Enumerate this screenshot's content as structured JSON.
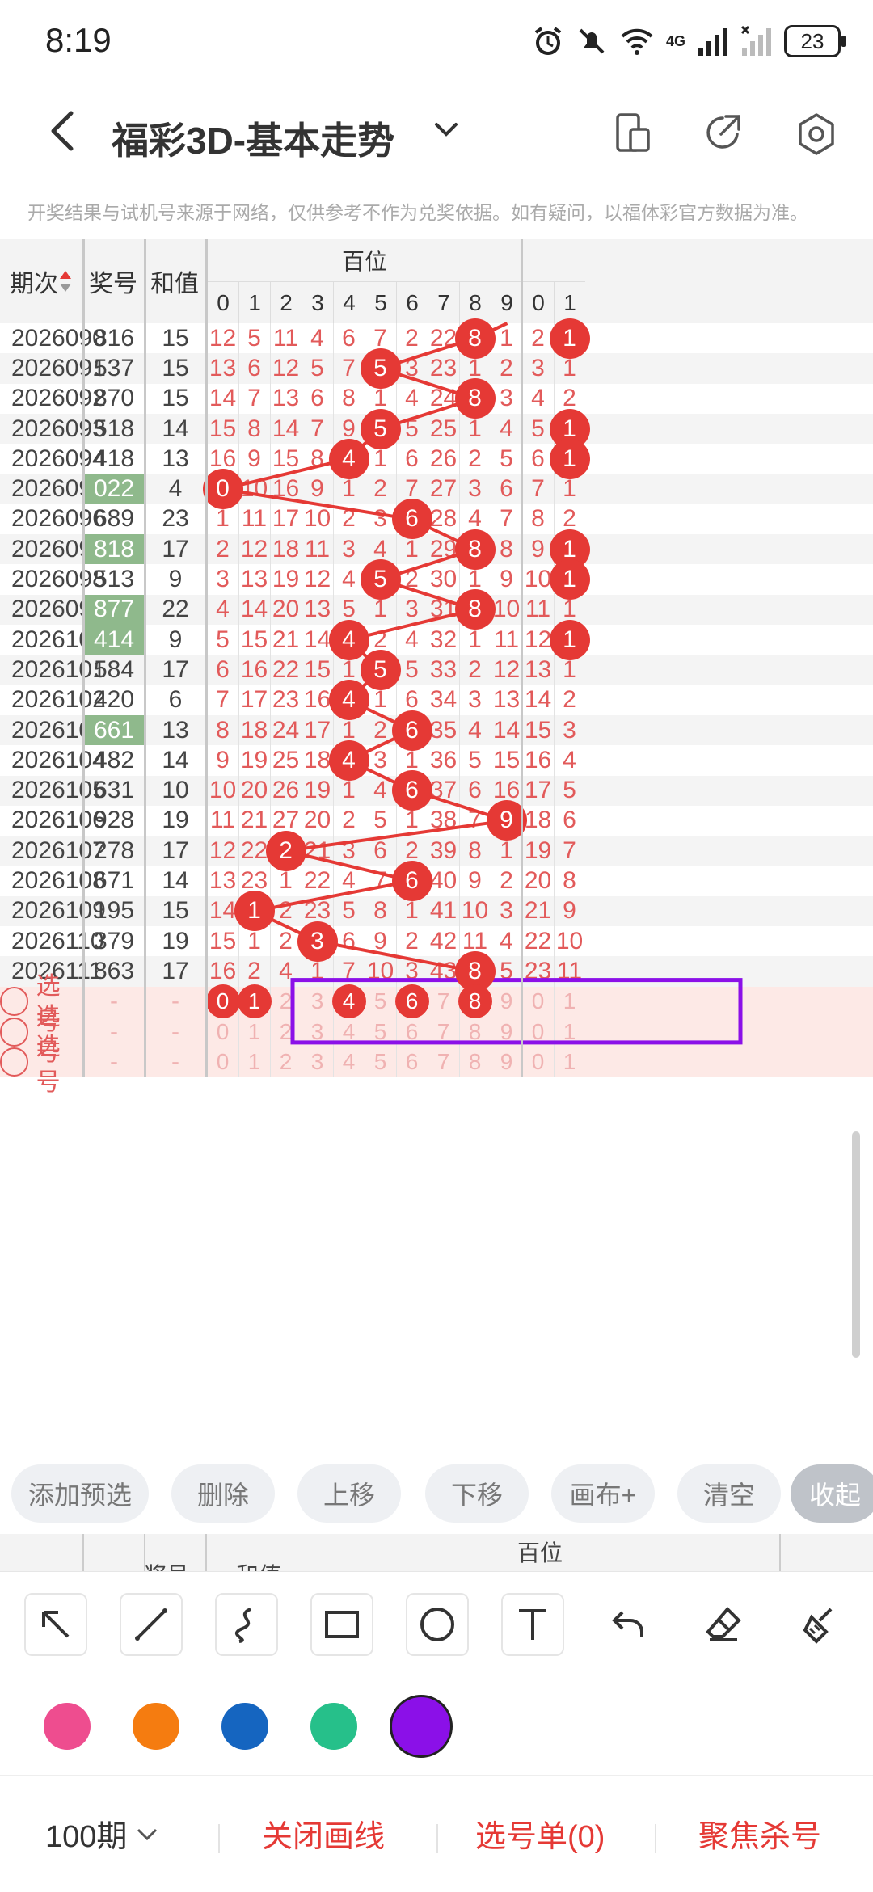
{
  "status": {
    "time": "8:19",
    "battery": "23",
    "network": "4G"
  },
  "header": {
    "title": "福彩3D-基本走势"
  },
  "disclaimer": "开奖结果与试机号来源于网络，仅供参考不作为兑奖依据。如有疑问，以福体彩官方数据为准。",
  "table": {
    "headers": {
      "period": "期次",
      "prize": "奖号",
      "sum": "和值",
      "hundreds": "百位",
      "tens_partial": [
        "0",
        "1"
      ]
    },
    "digits": [
      "0",
      "1",
      "2",
      "3",
      "4",
      "5",
      "6",
      "7",
      "8",
      "9"
    ],
    "rows": [
      {
        "period": "2026090",
        "prize": "816",
        "sum": "15",
        "hl": false,
        "h": [
          12,
          5,
          11,
          4,
          6,
          7,
          2,
          22,
          "8",
          1
        ],
        "t": [
          2,
          "1"
        ]
      },
      {
        "period": "2026091",
        "prize": "537",
        "sum": "15",
        "hl": false,
        "h": [
          13,
          6,
          12,
          5,
          7,
          "5",
          3,
          23,
          1,
          2
        ],
        "t": [
          3,
          1
        ]
      },
      {
        "period": "2026092",
        "prize": "870",
        "sum": "15",
        "hl": false,
        "h": [
          14,
          7,
          13,
          6,
          8,
          1,
          4,
          24,
          "8",
          3
        ],
        "t": [
          4,
          2
        ]
      },
      {
        "period": "2026093",
        "prize": "518",
        "sum": "14",
        "hl": false,
        "h": [
          15,
          8,
          14,
          7,
          9,
          "5",
          5,
          25,
          1,
          4
        ],
        "t": [
          5,
          "1"
        ]
      },
      {
        "period": "2026094",
        "prize": "418",
        "sum": "13",
        "hl": false,
        "h": [
          16,
          9,
          15,
          8,
          "4",
          1,
          6,
          26,
          2,
          5
        ],
        "t": [
          6,
          "1"
        ]
      },
      {
        "period": "2026095",
        "prize": "022",
        "sum": "4",
        "hl": true,
        "h": [
          "0",
          10,
          16,
          9,
          1,
          2,
          7,
          27,
          3,
          6
        ],
        "t": [
          7,
          1
        ]
      },
      {
        "period": "2026096",
        "prize": "689",
        "sum": "23",
        "hl": false,
        "h": [
          1,
          11,
          17,
          10,
          2,
          3,
          "6",
          28,
          4,
          7
        ],
        "t": [
          8,
          2
        ]
      },
      {
        "period": "2026097",
        "prize": "818",
        "sum": "17",
        "hl": true,
        "h": [
          2,
          12,
          18,
          11,
          3,
          4,
          1,
          29,
          "8",
          8
        ],
        "t": [
          9,
          "1"
        ]
      },
      {
        "period": "2026098",
        "prize": "513",
        "sum": "9",
        "hl": false,
        "h": [
          3,
          13,
          19,
          12,
          4,
          "5",
          2,
          30,
          1,
          9
        ],
        "t": [
          10,
          "1"
        ]
      },
      {
        "period": "2026099",
        "prize": "877",
        "sum": "22",
        "hl": true,
        "h": [
          4,
          14,
          20,
          13,
          5,
          1,
          3,
          31,
          "8",
          10
        ],
        "t": [
          11,
          1
        ]
      },
      {
        "period": "2026100",
        "prize": "414",
        "sum": "9",
        "hl": true,
        "h": [
          5,
          15,
          21,
          14,
          "4",
          2,
          4,
          32,
          1,
          11
        ],
        "t": [
          12,
          "1"
        ]
      },
      {
        "period": "2026101",
        "prize": "584",
        "sum": "17",
        "hl": false,
        "h": [
          6,
          16,
          22,
          15,
          1,
          "5",
          5,
          33,
          2,
          12
        ],
        "t": [
          13,
          1
        ]
      },
      {
        "period": "2026102",
        "prize": "420",
        "sum": "6",
        "hl": false,
        "h": [
          7,
          17,
          23,
          16,
          "4",
          1,
          6,
          34,
          3,
          13
        ],
        "t": [
          14,
          2
        ]
      },
      {
        "period": "2026103",
        "prize": "661",
        "sum": "13",
        "hl": true,
        "h": [
          8,
          18,
          24,
          17,
          1,
          2,
          "6",
          35,
          4,
          14
        ],
        "t": [
          15,
          3
        ]
      },
      {
        "period": "2026104",
        "prize": "482",
        "sum": "14",
        "hl": false,
        "h": [
          9,
          19,
          25,
          18,
          "4",
          3,
          1,
          36,
          5,
          15
        ],
        "t": [
          16,
          4
        ]
      },
      {
        "period": "2026105",
        "prize": "631",
        "sum": "10",
        "hl": false,
        "h": [
          10,
          20,
          26,
          19,
          1,
          4,
          "6",
          37,
          6,
          16
        ],
        "t": [
          17,
          5
        ]
      },
      {
        "period": "2026106",
        "prize": "928",
        "sum": "19",
        "hl": false,
        "h": [
          11,
          21,
          27,
          20,
          2,
          5,
          1,
          38,
          7,
          "9"
        ],
        "t": [
          18,
          6
        ]
      },
      {
        "period": "2026107",
        "prize": "278",
        "sum": "17",
        "hl": false,
        "h": [
          12,
          22,
          "2",
          21,
          3,
          6,
          2,
          39,
          8,
          1
        ],
        "t": [
          19,
          7
        ]
      },
      {
        "period": "2026108",
        "prize": "671",
        "sum": "14",
        "hl": false,
        "h": [
          13,
          23,
          1,
          22,
          4,
          7,
          "6",
          40,
          9,
          2
        ],
        "t": [
          20,
          8
        ]
      },
      {
        "period": "2026109",
        "prize": "195",
        "sum": "15",
        "hl": false,
        "h": [
          14,
          "1",
          2,
          23,
          5,
          8,
          1,
          41,
          10,
          3
        ],
        "t": [
          21,
          9
        ]
      },
      {
        "period": "2026110",
        "prize": "379",
        "sum": "19",
        "hl": false,
        "h": [
          15,
          1,
          2,
          "3",
          6,
          9,
          2,
          42,
          11,
          4
        ],
        "t": [
          22,
          10
        ]
      },
      {
        "period": "2026111",
        "prize": "863",
        "sum": "17",
        "hl": false,
        "h": [
          16,
          2,
          4,
          1,
          7,
          10,
          3,
          43,
          "8",
          5
        ],
        "t": [
          23,
          11
        ]
      }
    ],
    "select_rows": [
      {
        "label": "选号",
        "prize": "-",
        "sum": "-",
        "selected": [
          0,
          1,
          4,
          6,
          8
        ]
      },
      {
        "label": "选号",
        "prize": "-",
        "sum": "-",
        "selected": []
      },
      {
        "label": "选号",
        "prize": "-",
        "sum": "-",
        "selected": []
      }
    ]
  },
  "actions": [
    "添加预选",
    "删除",
    "上移",
    "下移",
    "画布+",
    "清空",
    "收起"
  ],
  "header2": {
    "prize": "奖号",
    "sum": "和值",
    "hundreds": "百位"
  },
  "draw_colors": [
    "#ee4d8f",
    "#f57c10",
    "#1565c0",
    "#26c08a",
    "#8b10e8"
  ],
  "bottom": {
    "period_select": "100期",
    "close_draw": "关闭画线",
    "ticket": "选号单(0)",
    "focus": "聚焦杀号"
  },
  "accent": "#e53935",
  "annotation_color": "#8b10e8"
}
